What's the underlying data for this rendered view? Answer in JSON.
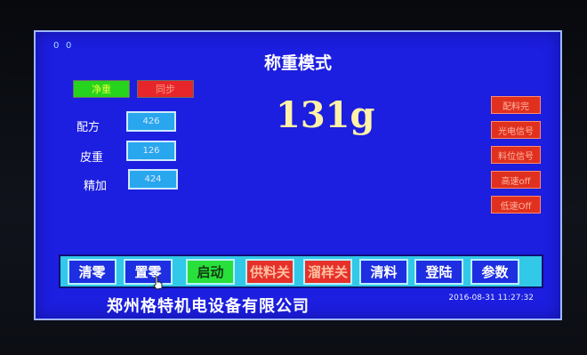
{
  "screen": {
    "corner_left_values": [
      "0",
      "0"
    ],
    "title": "称重模式"
  },
  "mode_buttons": [
    {
      "label": "净重"
    },
    {
      "label": "同步"
    }
  ],
  "form": {
    "rows": [
      {
        "label": "配方",
        "value": "426"
      },
      {
        "label": "皮重",
        "value": "126"
      },
      {
        "label": "精加",
        "value": "424"
      }
    ]
  },
  "weight": {
    "value": "131g"
  },
  "status_buttons": [
    {
      "label": "配料完"
    },
    {
      "label": "光电信号"
    },
    {
      "label": "料位信号"
    },
    {
      "label": "高速off"
    },
    {
      "label": "低速Off"
    }
  ],
  "toolbar": {
    "buttons": [
      {
        "label": "清零"
      },
      {
        "label": "置零"
      },
      {
        "label": "启动"
      },
      {
        "label": "供料关"
      },
      {
        "label": "溜样关"
      },
      {
        "label": "清料"
      },
      {
        "label": "登陆"
      },
      {
        "label": "参数"
      }
    ]
  },
  "footer": {
    "company": "郑州格特机电设备有限公司",
    "datetime": "2016-08-31 11:27:32"
  },
  "colors": {
    "screen_bg": "#1c1ee0",
    "toolbar_bg": "#32c8e8",
    "status_red": "#e0301e",
    "status_green": "#27d41d"
  }
}
